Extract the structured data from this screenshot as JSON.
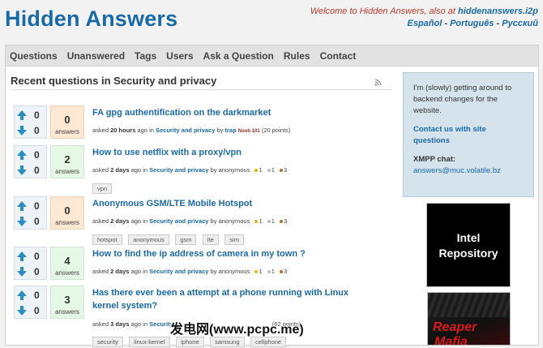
{
  "header": {
    "logo": "Hidden Answers",
    "welcome_prefix": "Welcome to Hidden Answers, also at",
    "welcome_link": "hiddenanswers.i2p",
    "langs": [
      "Español",
      "Português",
      "Русский"
    ],
    "lang_sep": "-"
  },
  "nav": [
    "Questions",
    "Unanswered",
    "Tags",
    "Users",
    "Ask a Question",
    "Rules",
    "Contact"
  ],
  "main": {
    "title": "Recent questions in Security and privacy"
  },
  "questions": [
    {
      "title": "FA gpg authentification on the darkmarket",
      "up": "0",
      "down": "0",
      "answers": "0",
      "answers_label": "answers",
      "meta": {
        "asked": "asked",
        "when": "20 hours",
        "ago": "ago in",
        "cat": "Security and privacy",
        "by": "by",
        "user": "trap",
        "badge": "Noob 101",
        "points": "(20 points)"
      },
      "tags": []
    },
    {
      "title": "How to use netflix with a proxy/vpn",
      "up": "0",
      "down": "0",
      "answers": "2",
      "answers_label": "answers",
      "meta": {
        "asked": "asked",
        "when": "2 days",
        "ago": "ago in",
        "cat": "Security and privacy",
        "by": "by anonymous",
        "b1": "1",
        "b2": "1",
        "b3": "3"
      },
      "tags": [
        "vpn"
      ]
    },
    {
      "title": "Anonymous GSM/LTE Mobile Hotspot",
      "up": "0",
      "down": "0",
      "answers": "0",
      "answers_label": "answers",
      "meta": {
        "asked": "asked",
        "when": "2 days",
        "ago": "ago in",
        "cat": "Security and privacy",
        "by": "by anonymous",
        "b1": "1",
        "b2": "1",
        "b3": "3"
      },
      "tags": [
        "hotspot",
        "anonymous",
        "gsm",
        "lte",
        "sim"
      ]
    },
    {
      "title": "How to find the ip address of camera in my town ?",
      "up": "0",
      "down": "0",
      "answers": "4",
      "answers_label": "answers",
      "meta": {
        "asked": "asked",
        "when": "2 days",
        "ago": "ago in",
        "cat": "Security and privacy",
        "by": "by anonymous",
        "b1": "1",
        "b2": "1",
        "b3": "3"
      },
      "tags": []
    },
    {
      "title": "Has there ever been a attempt at a phone running with Linux kernel system?",
      "up": "0",
      "down": "0",
      "answers": "3",
      "answers_label": "answers",
      "meta": {
        "asked": "asked",
        "when": "3 days",
        "ago": "ago in",
        "cat": "Security",
        "by": "",
        "points": "(62 points)"
      },
      "tags": [
        "security",
        "linux-kernel",
        "iphone",
        "samsung",
        "cellphone"
      ]
    }
  ],
  "sidebar": {
    "text": "I'm (slowly) getting around to backend changes for the website.",
    "contact": "Contact us with site questions",
    "xmpp_label": "XMPP chat:",
    "xmpp": "answers@muc.volatile.bz"
  },
  "ads": {
    "ad1": "Intel Repository",
    "ad2_line1": "Reaper",
    "ad2_line2": "Mafia"
  },
  "watermark": "发电网(www.pcpc.me)",
  "colors": {
    "link": "#1a6aa8",
    "welcome": "#c0392b",
    "zero_answers_bg": "#fde8d3",
    "some_answers_bg": "#e5f7e5",
    "sidebar_bg": "#d5e3ec"
  }
}
